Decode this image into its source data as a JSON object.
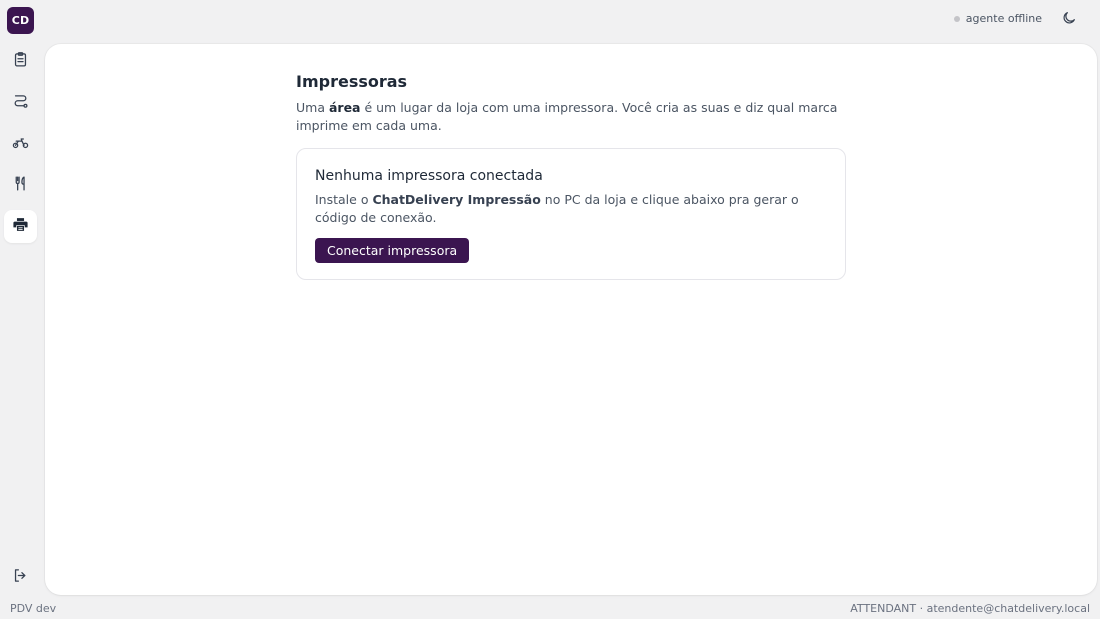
{
  "brand": {
    "initials": "CD",
    "color": "#3b1550"
  },
  "sidebar": {
    "items": [
      {
        "id": "orders",
        "icon": "clipboard-icon",
        "active": false
      },
      {
        "id": "routes",
        "icon": "route-icon",
        "active": false
      },
      {
        "id": "delivery",
        "icon": "motorcycle-icon",
        "active": false
      },
      {
        "id": "menu",
        "icon": "utensils-icon",
        "active": false
      },
      {
        "id": "printers",
        "icon": "printer-icon",
        "active": true
      }
    ],
    "logout_icon": "logout-icon"
  },
  "topbar": {
    "agent_status": "agente offline",
    "status_color": "#c4c4c8",
    "theme_icon": "moon-icon"
  },
  "page": {
    "title": "Impressoras",
    "desc_prefix": "Uma ",
    "desc_bold": "área",
    "desc_suffix": " é um lugar da loja com uma impressora. Você cria as suas e diz qual marca imprime em cada uma."
  },
  "card": {
    "title": "Nenhuma impressora conectada",
    "desc_prefix": "Instale o ",
    "desc_bold": "ChatDelivery Impressão",
    "desc_suffix": " no PC da loja e clique abaixo pra gerar o código de conexão.",
    "button_label": "Conectar impressora"
  },
  "footer": {
    "env": "PDV dev",
    "user": "ATTENDANT · atendente@chatdelivery.local"
  }
}
